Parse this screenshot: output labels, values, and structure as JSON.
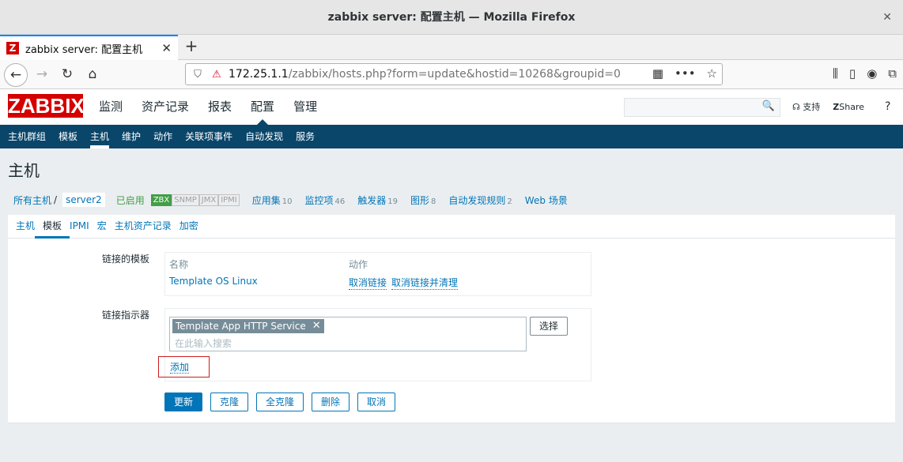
{
  "window": {
    "title": "zabbix server: 配置主机 — Mozilla Firefox",
    "close": "✕"
  },
  "browser": {
    "tab_title": "zabbix server: 配置主机",
    "tab_favicon": "Z",
    "url_host": "172.25.1.1",
    "url_path": "/zabbix/hosts.php?form=update&hostid=10268&groupid=0"
  },
  "zabbix": {
    "logo": "ZABBIX",
    "main_menu": [
      "监测",
      "资产记录",
      "报表",
      "配置",
      "管理"
    ],
    "support": "支持",
    "share": "Share",
    "help": "?",
    "sub_menu": [
      "主机群组",
      "模板",
      "主机",
      "维护",
      "动作",
      "关联项事件",
      "自动发现",
      "服务"
    ],
    "page_title": "主机",
    "breadcrumb": {
      "all_hosts": "所有主机",
      "sep": "/",
      "current": "server2",
      "status": "已启用",
      "availability": [
        "ZBX",
        "SNMP",
        "JMX",
        "IPMI"
      ],
      "links": [
        {
          "label": "应用集",
          "count": "10"
        },
        {
          "label": "监控项",
          "count": "46"
        },
        {
          "label": "触发器",
          "count": "19"
        },
        {
          "label": "图形",
          "count": "8"
        },
        {
          "label": "自动发现规则",
          "count": "2"
        },
        {
          "label": "Web 场景",
          "count": ""
        }
      ]
    },
    "tabs": [
      "主机",
      "模板",
      "IPMI",
      "宏",
      "主机资产记录",
      "加密"
    ],
    "form": {
      "linked_label": "链接的模板",
      "col_name": "名称",
      "col_action": "动作",
      "template_name": "Template OS Linux",
      "unlink": "取消链接",
      "unlink_clear": "取消链接并清理",
      "indicator_label": "链接指示器",
      "chip": "Template App HTTP Service",
      "chip_remove": "✕",
      "placeholder": "在此输入搜索",
      "select": "选择",
      "add": "添加",
      "buttons": [
        "更新",
        "克隆",
        "全克隆",
        "删除",
        "取消"
      ]
    }
  }
}
